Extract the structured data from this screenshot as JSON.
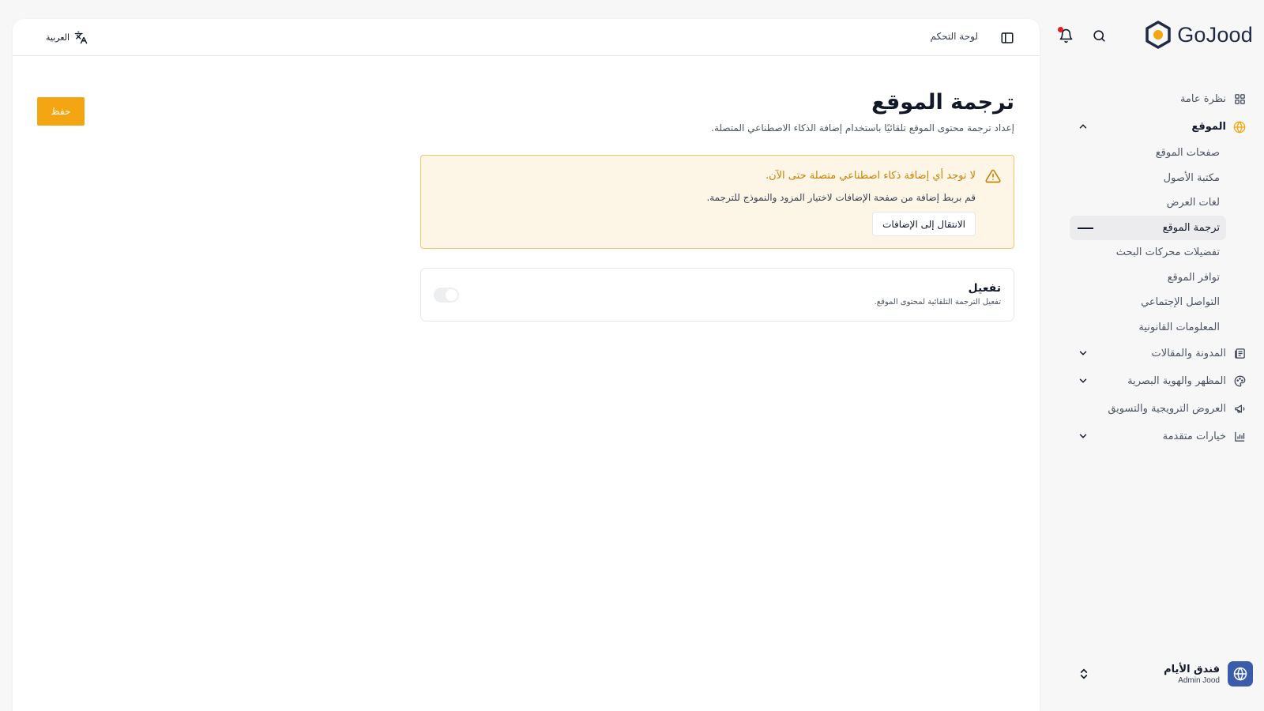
{
  "brand": {
    "name": "GoJood"
  },
  "sidebar": {
    "items": [
      {
        "label": "نظرة عامة"
      },
      {
        "label": "الموقع"
      },
      {
        "label": "المدونة والمقالات"
      },
      {
        "label": "المظهر والهوية البصرية"
      },
      {
        "label": "العروض الترويجية والتسويق"
      },
      {
        "label": "خيارات متقدمة"
      }
    ],
    "site_sub_items": [
      {
        "label": "صفحات الموقع"
      },
      {
        "label": "مكتبة الأصول"
      },
      {
        "label": "لغات العرض"
      },
      {
        "label": "ترجمة الموقع",
        "active": true
      },
      {
        "label": "تفضيلات محركات البحث"
      },
      {
        "label": "توافر الموقع"
      },
      {
        "label": "التواصل الإجتماعي"
      },
      {
        "label": "المعلومات القانونية"
      }
    ],
    "account": {
      "name": "فندق الأيام",
      "subtitle": "Admin Jood"
    }
  },
  "topbar": {
    "breadcrumb": "لوحة التحكم",
    "language": "العربية"
  },
  "page": {
    "title": "ترجمة الموقع",
    "description": "إعداد ترجمة محتوى الموقع تلقائيًا باستخدام إضافة الذكاء الاصطناعي المتصلة.",
    "save_label": "حفظ"
  },
  "alert": {
    "title": "لا توجد أي إضافة ذكاء اصطناعي متصلة حتى الآن.",
    "text": "قم بربط إضافة من صفحة الإضافات لاختيار المزود والنموذج للترجمة.",
    "button_label": "الانتقال إلى الإضافات"
  },
  "toggle_card": {
    "title": "تفعيل",
    "subtitle": "تفعيل الترجمة التلقائية لمحتوى الموقع.",
    "enabled": false
  },
  "colors": {
    "accent": "#f4a612",
    "alert_bg": "#fdf6e7",
    "alert_border": "#f6c66a",
    "alert_title": "#c88205",
    "notification_dot": "#e11d1d",
    "account_logo": "#3b5bab"
  }
}
